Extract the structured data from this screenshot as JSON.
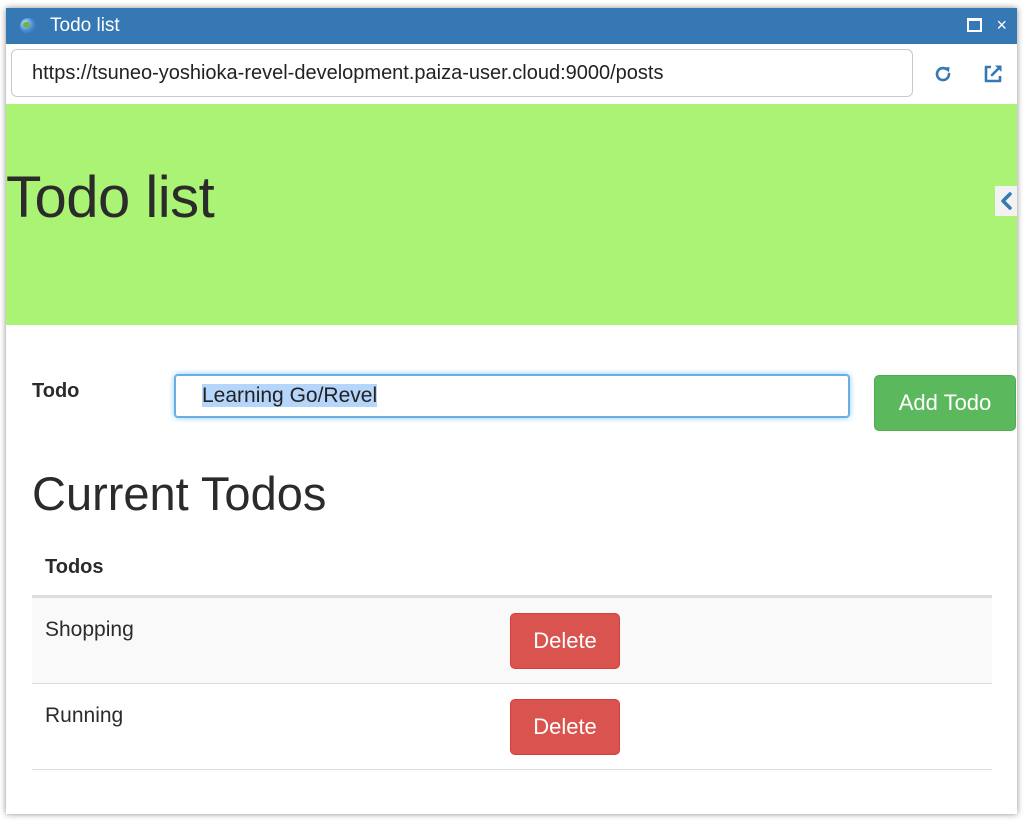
{
  "window": {
    "title": "Todo list",
    "url": "https://tsuneo-yoshioka-revel-development.paiza-user.cloud:9000/posts"
  },
  "icons": {
    "window": "globe-icon",
    "maximize": "maximize-icon",
    "close": "close-icon",
    "reload": "reload-icon",
    "open_external": "external-link-icon",
    "hero_toggle": "chevron-left-icon"
  },
  "close_glyph": "×",
  "hero": {
    "title": "Todo list",
    "background": "#abf374"
  },
  "form": {
    "label": "Todo",
    "input_value": "Learning Go/Revel",
    "add_button": "Add Todo"
  },
  "list": {
    "heading": "Current Todos",
    "column_header": "Todos",
    "items": [
      {
        "text": "Shopping",
        "delete_label": "Delete"
      },
      {
        "text": "Running",
        "delete_label": "Delete"
      }
    ]
  },
  "colors": {
    "titlebar": "#3578b4",
    "add_button": "#5cb85c",
    "delete_button": "#d9534f"
  }
}
